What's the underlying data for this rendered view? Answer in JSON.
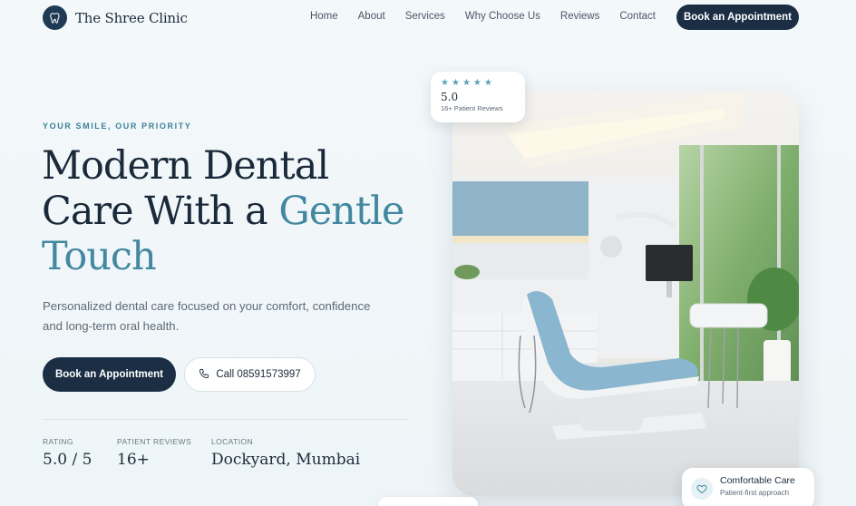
{
  "brand": {
    "name": "The Shree Clinic",
    "logo_icon": "tooth-icon"
  },
  "nav": {
    "links": [
      "Home",
      "About",
      "Services",
      "Why Choose Us",
      "Reviews",
      "Contact"
    ],
    "cta": "Book an Appointment"
  },
  "hero": {
    "eyebrow": "YOUR SMILE, OUR PRIORITY",
    "headline_line1": "Modern Dental",
    "headline_line2_a": "Care With a ",
    "headline_line2_b": "Gentle",
    "headline_line3": "Touch",
    "subtext": "Personalized dental care focused on your comfort, confidence and long-term oral health.",
    "primary_button": "Book an Appointment",
    "secondary_button": "Call 08591573997",
    "secondary_icon": "phone-icon"
  },
  "stats": [
    {
      "label": "RATING",
      "value": "5.0 / 5"
    },
    {
      "label": "PATIENT REVIEWS",
      "value": "16+"
    },
    {
      "label": "LOCATION",
      "value": "Dockyard, Mumbai"
    }
  ],
  "rating_card": {
    "stars": 5,
    "score": "5.0",
    "subtitle": "16+ Patient Reviews"
  },
  "comfort_card": {
    "title": "Comfortable Care",
    "subtitle": "Patient-first approach",
    "icon": "heart-icon"
  },
  "colors": {
    "primary": "#1b2e44",
    "accent": "#4388a0",
    "background": "#f3f8fa"
  }
}
